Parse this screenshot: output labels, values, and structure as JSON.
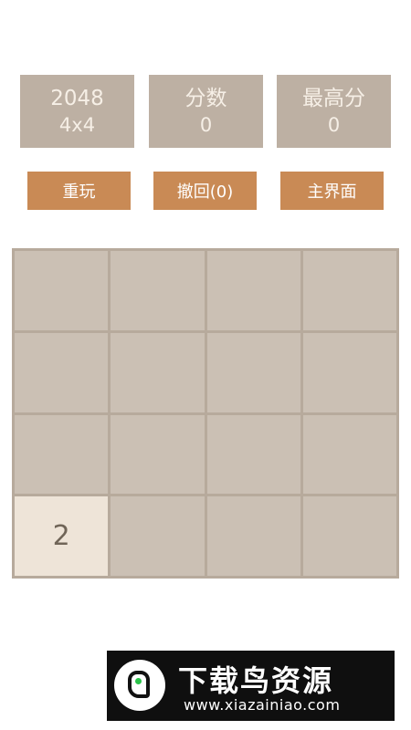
{
  "stats": {
    "mode": {
      "title": "2048",
      "value": "4x4"
    },
    "score": {
      "title": "分数",
      "value": "0"
    },
    "best": {
      "title": "最高分",
      "value": "0"
    }
  },
  "buttons": {
    "restart": "重玩",
    "undo": "撤回(0)",
    "main_menu": "主界面"
  },
  "board": {
    "rows": [
      [
        "",
        "",
        "",
        ""
      ],
      [
        "",
        "",
        "",
        ""
      ],
      [
        "",
        "",
        "",
        ""
      ],
      [
        "2",
        "",
        "",
        ""
      ]
    ]
  },
  "banner": {
    "title": "下载鸟资源",
    "url": "www.xiazainiao.com"
  },
  "colors": {
    "stat_bg": "#bdb0a3",
    "button_bg": "#c98a55",
    "board_bg": "#b7aa9c",
    "empty_cell": "#cbc0b4",
    "tile_2": "#eee4d8"
  }
}
